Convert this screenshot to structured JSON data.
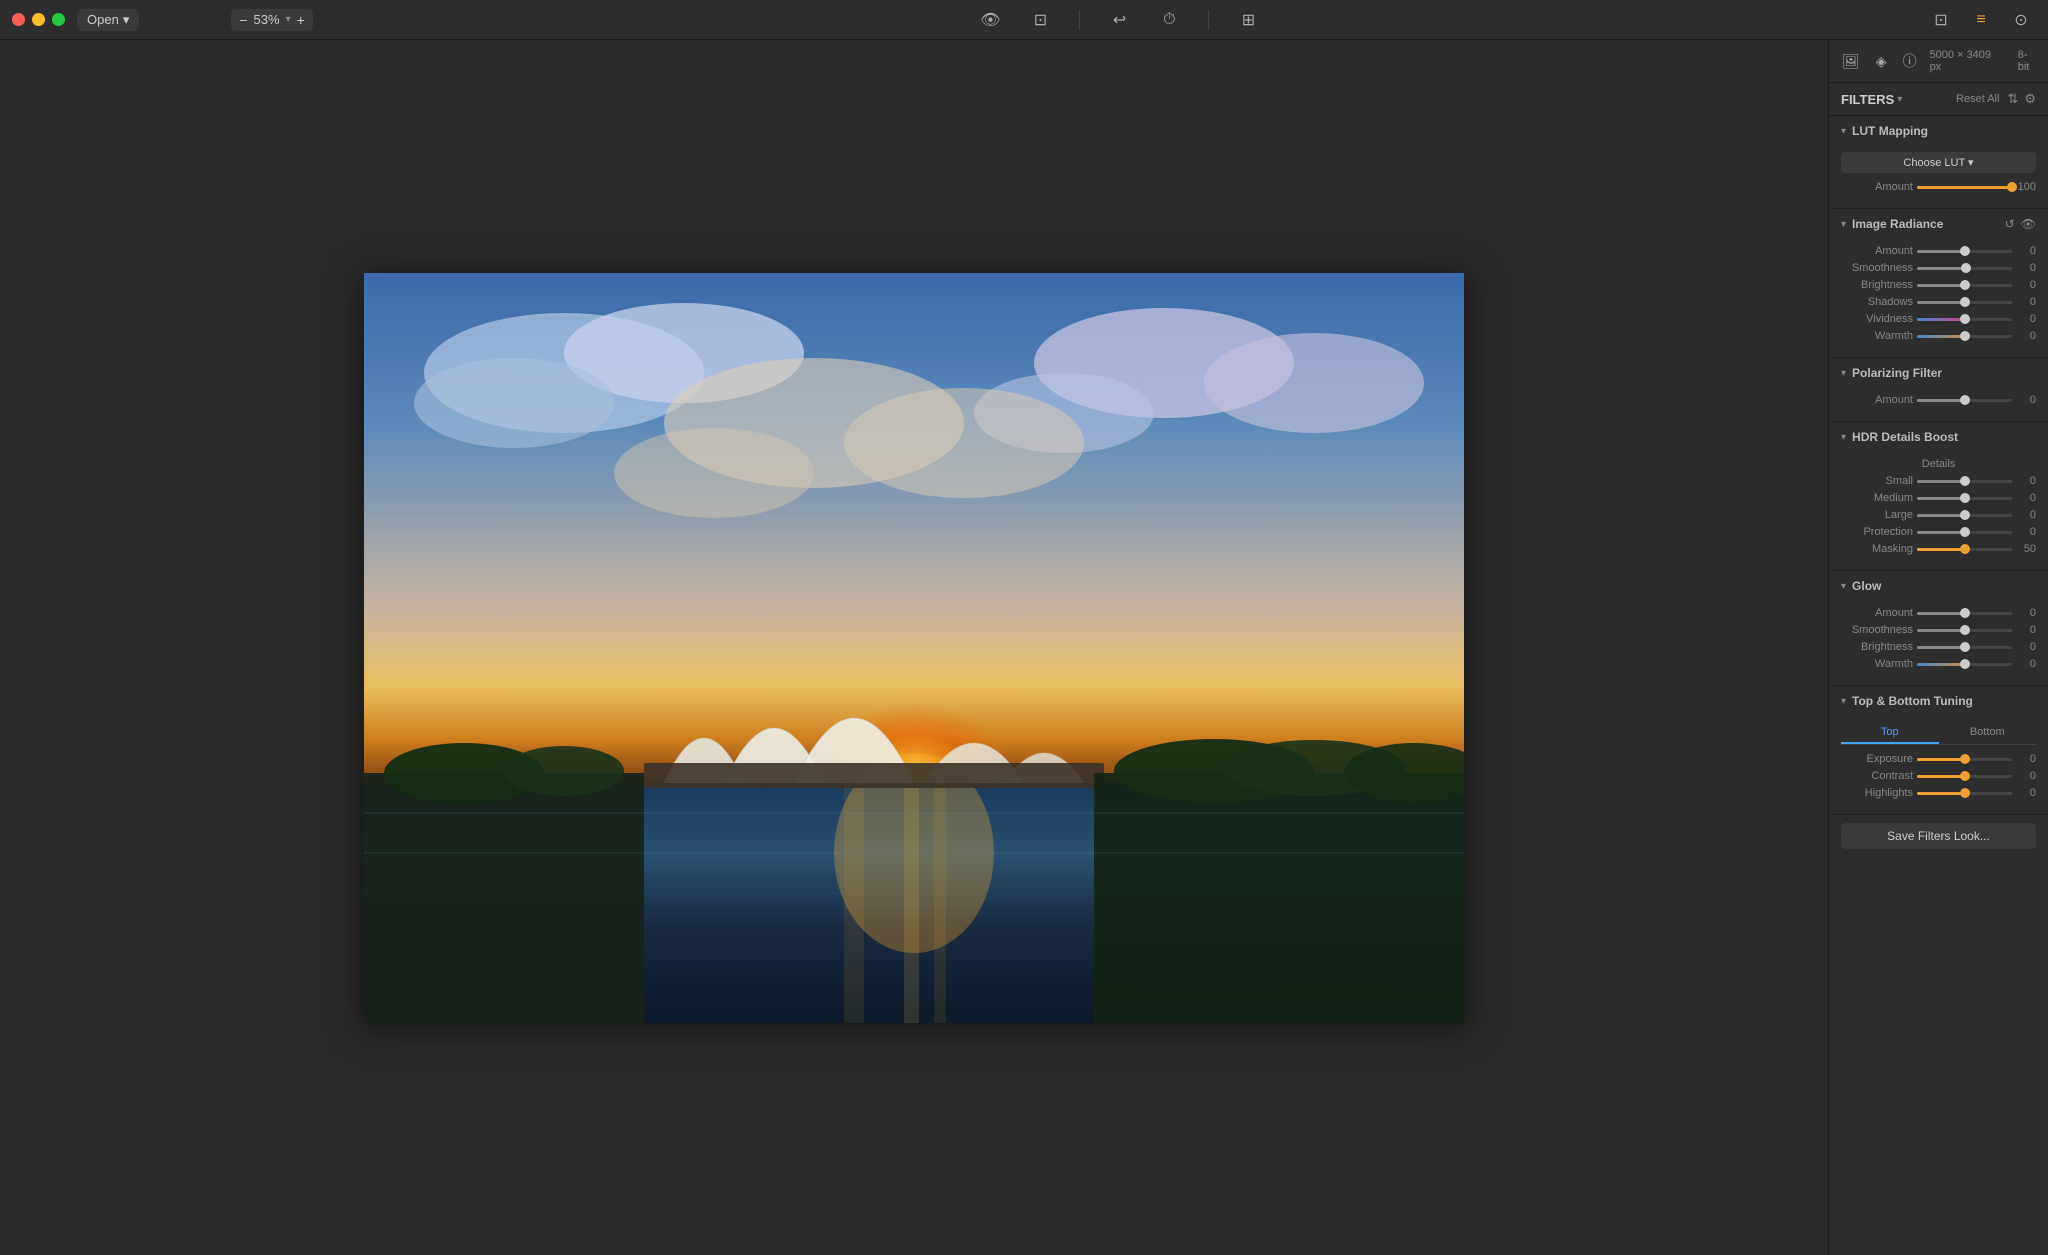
{
  "titlebar": {
    "open_label": "Open",
    "open_chevron": "▾",
    "zoom": "53%",
    "zoom_minus": "−",
    "zoom_plus": "+",
    "tools": [
      "👁",
      "⊡",
      "↩",
      "⏱",
      "⊞"
    ],
    "right_icons": [
      "⊡",
      "≡",
      "⊙"
    ]
  },
  "panel": {
    "image_info": "5000 × 3409 px",
    "bit_depth": "8-bit",
    "filters_title": "FILTERS",
    "reset_all": "Reset All"
  },
  "lut_mapping": {
    "title": "LUT Mapping",
    "dropdown_label": "Choose LUT",
    "amount_label": "Amount",
    "amount_value": "100"
  },
  "image_radiance": {
    "title": "Image Radiance",
    "rows": [
      {
        "label": "Amount",
        "value": "0",
        "percent": 50
      },
      {
        "label": "Smoothness",
        "value": "0",
        "percent": 52
      },
      {
        "label": "Brightness",
        "value": "0",
        "percent": 50
      },
      {
        "label": "Shadows",
        "value": "0",
        "percent": 50
      },
      {
        "label": "Vividness",
        "value": "0",
        "percent": 50
      },
      {
        "label": "Warmth",
        "value": "0",
        "percent": 50
      }
    ]
  },
  "polarizing_filter": {
    "title": "Polarizing Filter",
    "rows": [
      {
        "label": "Amount",
        "value": "0",
        "percent": 50
      }
    ]
  },
  "hdr_details_boost": {
    "title": "HDR Details Boost",
    "details_label": "Details",
    "rows": [
      {
        "label": "Small",
        "value": "0",
        "percent": 50
      },
      {
        "label": "Medium",
        "value": "0",
        "percent": 50
      },
      {
        "label": "Large",
        "value": "0",
        "percent": 50
      }
    ],
    "protection_label": "Protection",
    "protection_value": "0",
    "protection_percent": 50,
    "masking_label": "Masking",
    "masking_value": "50",
    "masking_percent": 50
  },
  "glow": {
    "title": "Glow",
    "rows": [
      {
        "label": "Amount",
        "value": "0",
        "percent": 50
      },
      {
        "label": "Smoothness",
        "value": "0",
        "percent": 50
      },
      {
        "label": "Brightness",
        "value": "0",
        "percent": 50
      },
      {
        "label": "Warmth",
        "value": "0",
        "percent": 50
      }
    ]
  },
  "top_bottom_tuning": {
    "title": "Top & Bottom Tuning",
    "tab_top": "Top",
    "tab_bottom": "Bottom",
    "rows": [
      {
        "label": "Exposure",
        "value": "0",
        "percent": 50
      },
      {
        "label": "Contrast",
        "value": "0",
        "percent": 50
      },
      {
        "label": "Highlights",
        "value": "0",
        "percent": 50
      }
    ]
  },
  "save_button_label": "Save Filters Look..."
}
